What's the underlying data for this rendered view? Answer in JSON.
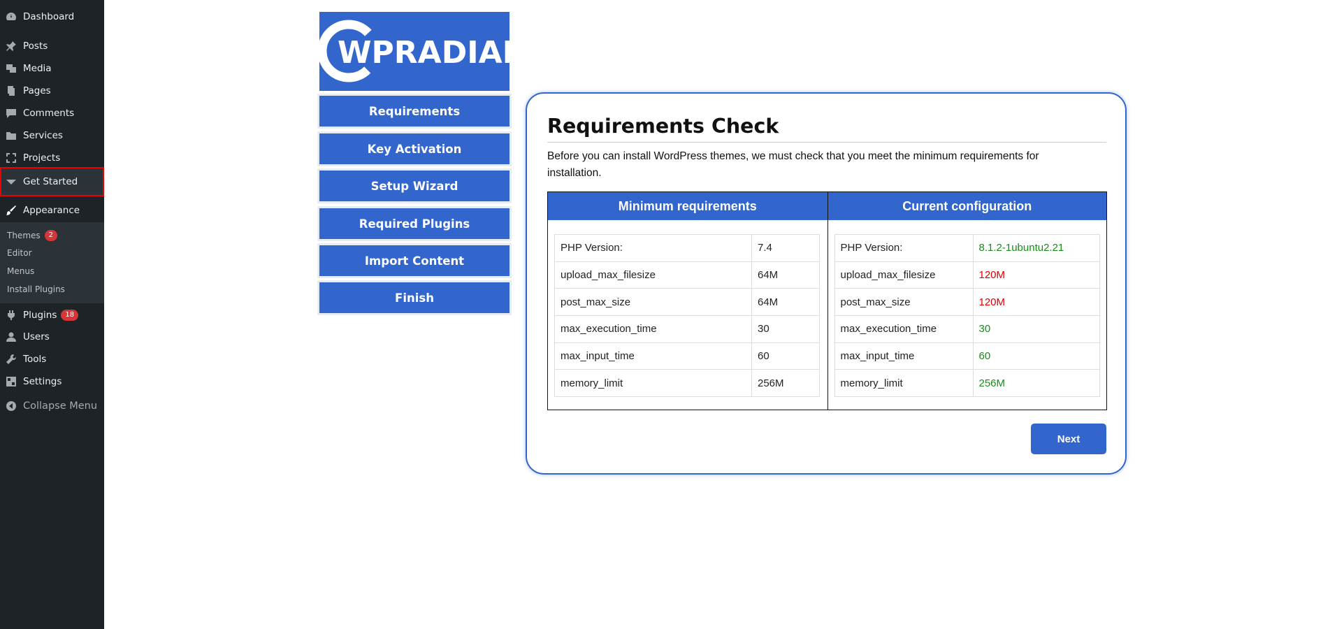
{
  "admin_menu": {
    "items": [
      {
        "label": "Dashboard",
        "icon": "dashboard-icon"
      },
      {
        "label": "Posts",
        "icon": "pin-icon"
      },
      {
        "label": "Media",
        "icon": "media-icon"
      },
      {
        "label": "Pages",
        "icon": "pages-icon"
      },
      {
        "label": "Comments",
        "icon": "comment-icon"
      },
      {
        "label": "Services",
        "icon": "folder-icon"
      },
      {
        "label": "Projects",
        "icon": "expand-icon"
      },
      {
        "label": "Get Started",
        "icon": "chevron-down-icon"
      },
      {
        "label": "Appearance",
        "icon": "brush-icon"
      },
      {
        "label": "Plugins",
        "icon": "plug-icon",
        "badge": "18"
      },
      {
        "label": "Users",
        "icon": "user-icon"
      },
      {
        "label": "Tools",
        "icon": "wrench-icon"
      },
      {
        "label": "Settings",
        "icon": "settings-icon"
      }
    ],
    "submenu": [
      {
        "label": "Themes",
        "badge": "2"
      },
      {
        "label": "Editor"
      },
      {
        "label": "Menus"
      },
      {
        "label": "Install Plugins"
      }
    ],
    "collapse_label": "Collapse Menu"
  },
  "wizard": {
    "logo_text": "WPRADIANT",
    "steps": [
      "Requirements",
      "Key Activation",
      "Setup Wizard",
      "Required Plugins",
      "Import Content",
      "Finish"
    ]
  },
  "card": {
    "title": "Requirements Check",
    "description": "Before you can install WordPress themes, we must check that you meet the minimum requirements for installation.",
    "min_header": "Minimum requirements",
    "cur_header": "Current configuration",
    "rows": [
      {
        "key": "PHP Version:",
        "min": "7.4",
        "current": "8.1.2-1ubuntu2.21",
        "status": "ok"
      },
      {
        "key": "upload_max_filesize",
        "min": "64M",
        "current": "120M",
        "status": "bad"
      },
      {
        "key": "post_max_size",
        "min": "64M",
        "current": "120M",
        "status": "bad"
      },
      {
        "key": "max_execution_time",
        "min": "30",
        "current": "30",
        "status": "ok"
      },
      {
        "key": "max_input_time",
        "min": "60",
        "current": "60",
        "status": "ok"
      },
      {
        "key": "memory_limit",
        "min": "256M",
        "current": "256M",
        "status": "ok"
      }
    ],
    "next_label": "Next"
  },
  "colors": {
    "brand": "#3366cc",
    "sidebar": "#1d2327",
    "ok": "#1a8a1a",
    "bad": "#e00000"
  }
}
